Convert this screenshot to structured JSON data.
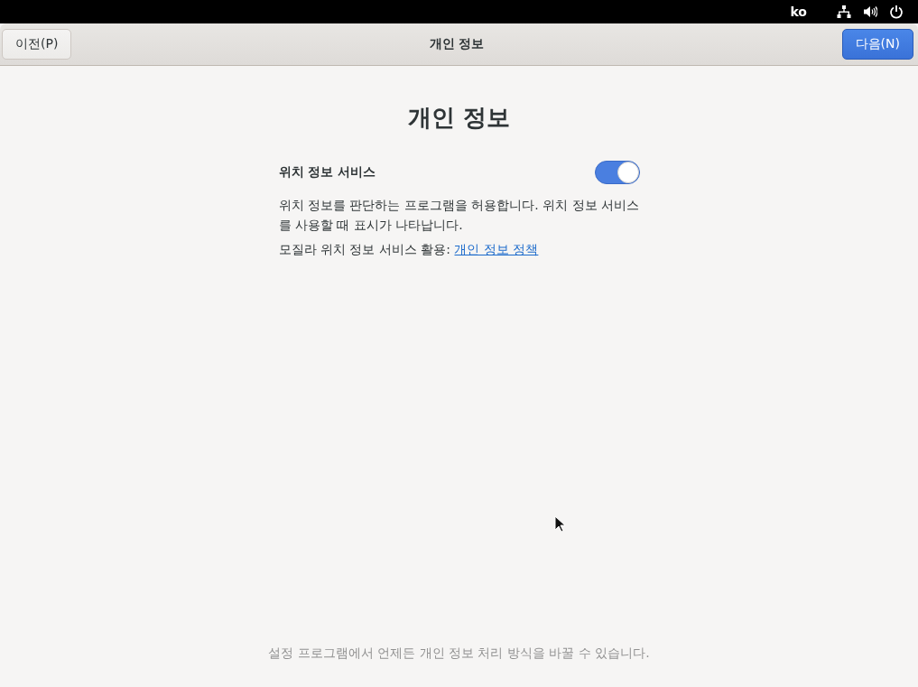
{
  "top_bar": {
    "keyboard_layout": "ko"
  },
  "header": {
    "back_button": "이전(P)",
    "title": "개인 정보",
    "next_button": "다음(N)"
  },
  "page": {
    "heading": "개인 정보",
    "location_services": {
      "label": "위치 정보 서비스",
      "on": true,
      "description": "위치 정보를 판단하는 프로그램을 허용합니다. 위치 정보 서비스를 사용할 때 표시가 나타납니다.",
      "policy_prefix": "모질라 위치 정보 서비스 활용:",
      "policy_link": "개인 정보 정책"
    },
    "footer_note": "설정 프로그램에서 언제든 개인 정보 처리 방식을 바꿀 수 있습니다."
  }
}
